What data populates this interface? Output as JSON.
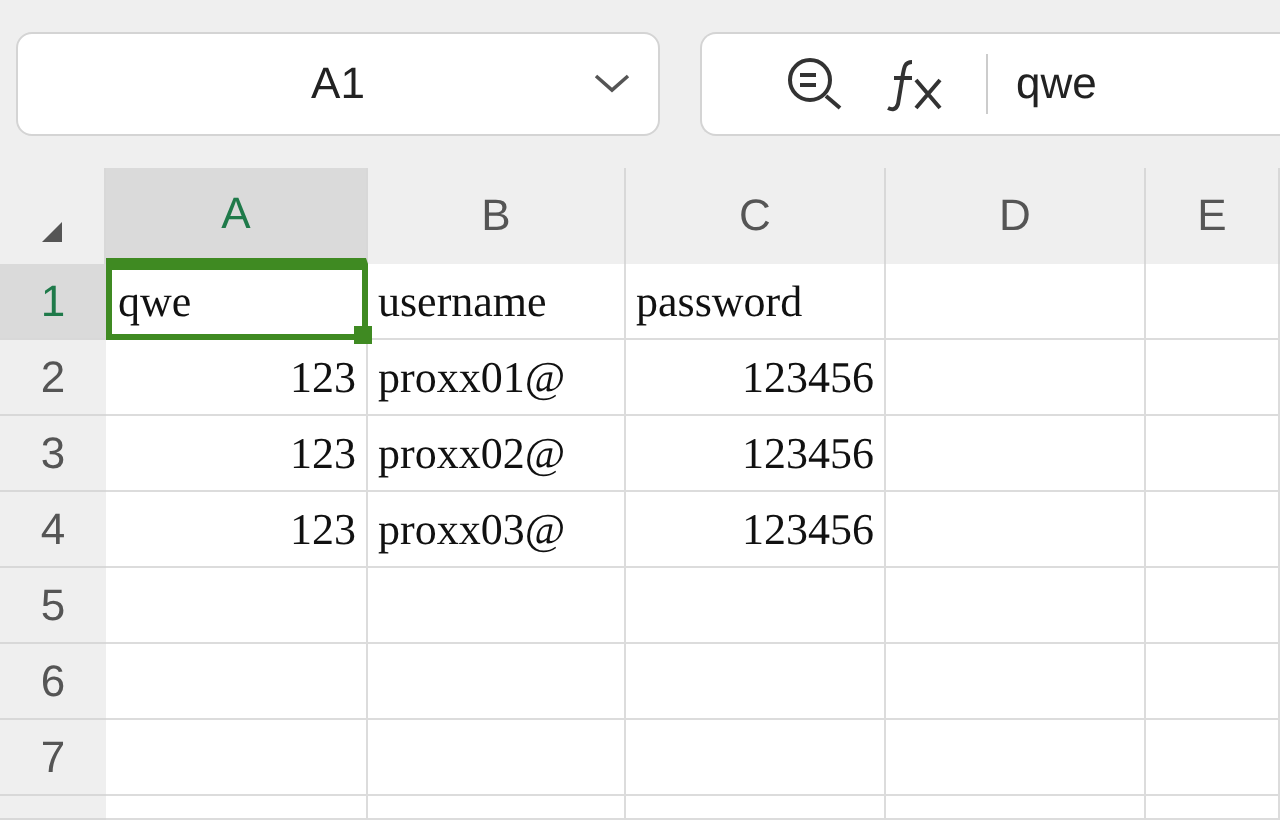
{
  "name_box": {
    "value": "A1"
  },
  "formula_bar": {
    "value": "qwe"
  },
  "columns": [
    {
      "label": "A",
      "selected": true
    },
    {
      "label": "B",
      "selected": false
    },
    {
      "label": "C",
      "selected": false
    },
    {
      "label": "D",
      "selected": false
    },
    {
      "label": "E",
      "selected": false
    }
  ],
  "rows": [
    {
      "label": "1",
      "selected": true,
      "cells": [
        {
          "text": "qwe",
          "kind": "text",
          "selected": true
        },
        {
          "text": "username",
          "kind": "text",
          "selected": false
        },
        {
          "text": "password",
          "kind": "text",
          "selected": false
        }
      ]
    },
    {
      "label": "2",
      "selected": false,
      "cells": [
        {
          "text": "123",
          "kind": "number",
          "selected": false
        },
        {
          "text": "proxx01@",
          "kind": "text",
          "selected": false
        },
        {
          "text": "123456",
          "kind": "number",
          "selected": false
        }
      ]
    },
    {
      "label": "3",
      "selected": false,
      "cells": [
        {
          "text": "123",
          "kind": "number",
          "selected": false
        },
        {
          "text": "proxx02@",
          "kind": "text",
          "selected": false
        },
        {
          "text": "123456",
          "kind": "number",
          "selected": false
        }
      ]
    },
    {
      "label": "4",
      "selected": false,
      "cells": [
        {
          "text": "123",
          "kind": "number",
          "selected": false
        },
        {
          "text": "proxx03@",
          "kind": "text",
          "selected": false
        },
        {
          "text": "123456",
          "kind": "number",
          "selected": false
        }
      ]
    },
    {
      "label": "5",
      "selected": false
    },
    {
      "label": "6",
      "selected": false
    },
    {
      "label": "7",
      "selected": false
    }
  ]
}
